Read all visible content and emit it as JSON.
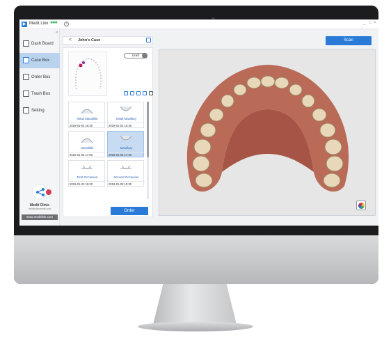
{
  "app": {
    "title": "Medit Link",
    "status_dots": "●●●",
    "minimize": "_",
    "maximize": "□",
    "close": "×"
  },
  "sidebar": {
    "collapse": "«",
    "items": [
      {
        "label": "Dash Board",
        "icon": "dashboard-icon"
      },
      {
        "label": "Case Box",
        "icon": "case-box-icon",
        "active": true
      },
      {
        "label": "Order Box",
        "icon": "order-box-icon"
      },
      {
        "label": "Trash Box",
        "icon": "trash-box-icon"
      },
      {
        "label": "Setting",
        "icon": "settings-icon"
      }
    ],
    "clinic_name": "Medit Clinic",
    "clinic_site": "meditclinicmedit.com",
    "url": "www.meditlink.com"
  },
  "case": {
    "back": "<",
    "title": "John's Case",
    "status": "Draft",
    "scans": [
      {
        "name": "Initial Mandible",
        "date": "2019-01-02 16:30"
      },
      {
        "name": "Initial Maxillary",
        "date": "2019-01-02 16:45"
      },
      {
        "name": "Mandible",
        "date": "2019-01-02 17:00"
      },
      {
        "name": "Maxillary",
        "date": "2019-01-02 17:30",
        "selected": true
      },
      {
        "name": "First Occlusion",
        "date": "2019-01-03 15:30"
      },
      {
        "name": "Second Occlusion",
        "date": "2019-01-03 15:30"
      }
    ],
    "order_label": "Order"
  },
  "toolbar": {
    "scan_label": "Scan"
  },
  "colors": {
    "accent": "#2a7bd8",
    "selected": "#c7dcf3",
    "sidebar_active": "#b9d3ef"
  }
}
